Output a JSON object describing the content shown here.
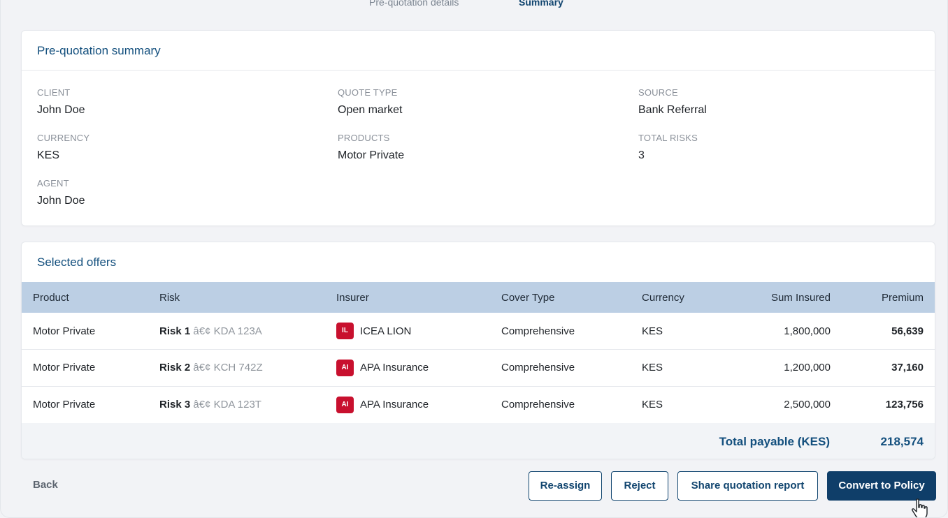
{
  "steps": {
    "previous": "Pre-quotation details",
    "current": "Summary"
  },
  "summary": {
    "title": "Pre-quotation summary",
    "fields": {
      "client": {
        "label": "CLIENT",
        "value": "John Doe"
      },
      "quote_type": {
        "label": "QUOTE TYPE",
        "value": "Open market"
      },
      "source": {
        "label": "SOURCE",
        "value": "Bank Referral"
      },
      "currency": {
        "label": "CURRENCY",
        "value": "KES"
      },
      "products": {
        "label": "PRODUCTS",
        "value": "Motor Private"
      },
      "total_risks": {
        "label": "TOTAL RISKS",
        "value": "3"
      },
      "agent": {
        "label": "AGENT",
        "value": "John Doe"
      }
    }
  },
  "offers": {
    "title": "Selected offers",
    "columns": {
      "product": "Product",
      "risk": "Risk",
      "insurer": "Insurer",
      "cover_type": "Cover Type",
      "currency": "Currency",
      "sum_insured": "Sum Insured",
      "premium": "Premium"
    },
    "rows": [
      {
        "product": "Motor Private",
        "risk_name": "Risk 1",
        "risk_sep": "â€¢",
        "plate": "KDA 123A",
        "insurer_badge": "IL",
        "insurer": "ICEA LION",
        "cover_type": "Comprehensive",
        "currency": "KES",
        "sum_insured": "1,800,000",
        "premium": "56,639"
      },
      {
        "product": "Motor Private",
        "risk_name": "Risk 2",
        "risk_sep": "â€¢",
        "plate": "KCH 742Z",
        "insurer_badge": "AI",
        "insurer": "APA Insurance",
        "cover_type": "Comprehensive",
        "currency": "KES",
        "sum_insured": "1,200,000",
        "premium": "37,160"
      },
      {
        "product": "Motor Private",
        "risk_name": "Risk 3",
        "risk_sep": "â€¢",
        "plate": "KDA 123T",
        "insurer_badge": "AI",
        "insurer": "APA Insurance",
        "cover_type": "Comprehensive",
        "currency": "KES",
        "sum_insured": "2,500,000",
        "premium": "123,756"
      }
    ],
    "total_label": "Total payable (KES)",
    "total_value": "218,574"
  },
  "actions": {
    "back": "Back",
    "reassign": "Re-assign",
    "reject": "Reject",
    "share": "Share quotation report",
    "convert": "Convert to Policy"
  },
  "colors": {
    "accent": "#14507e",
    "primary_button": "#0f3e69",
    "table_header": "#bccfe4",
    "insurer_badge": "#c8102e"
  },
  "icons": {
    "cursor": "hand-pointer-icon"
  }
}
